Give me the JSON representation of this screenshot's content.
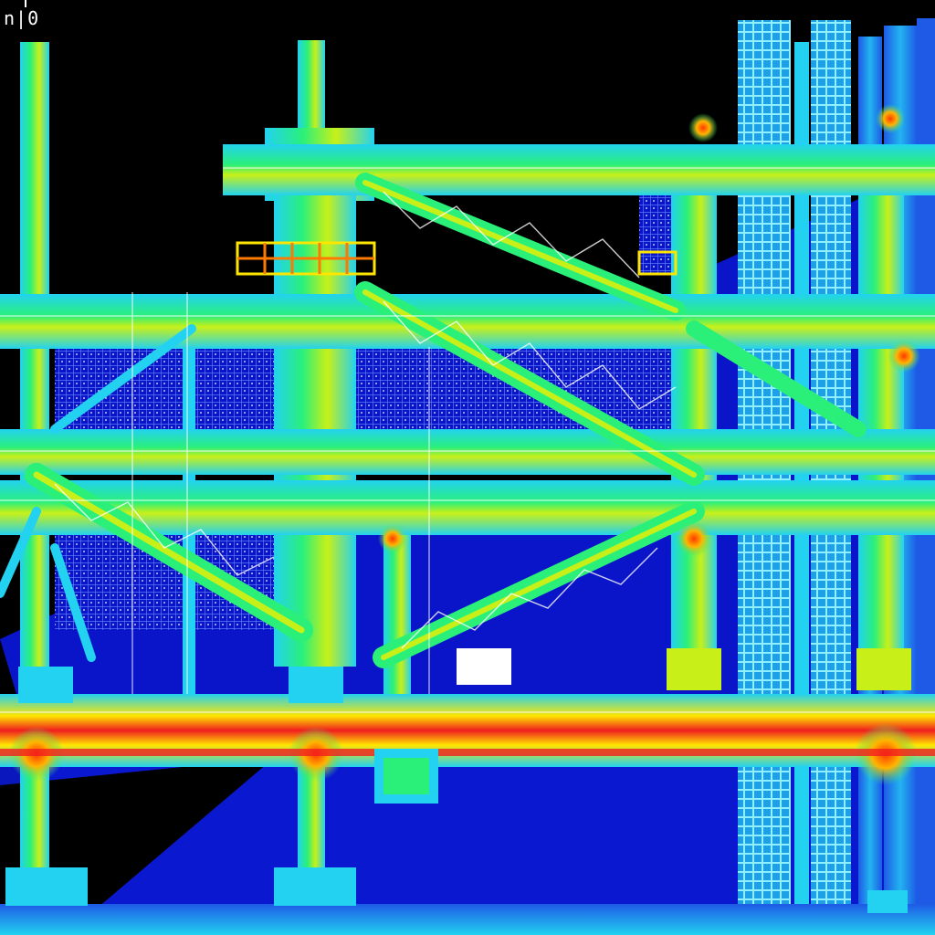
{
  "corner_label": "n|0",
  "palette": {
    "background": "#000000",
    "deep": "#0a14c8",
    "cold": "#1e5ae6",
    "cool": "#22d2f0",
    "mid": "#2af07a",
    "warm": "#c8f018",
    "hot": "#ffe600",
    "hotter": "#ff7a00",
    "hottest": "#f01e1e"
  }
}
